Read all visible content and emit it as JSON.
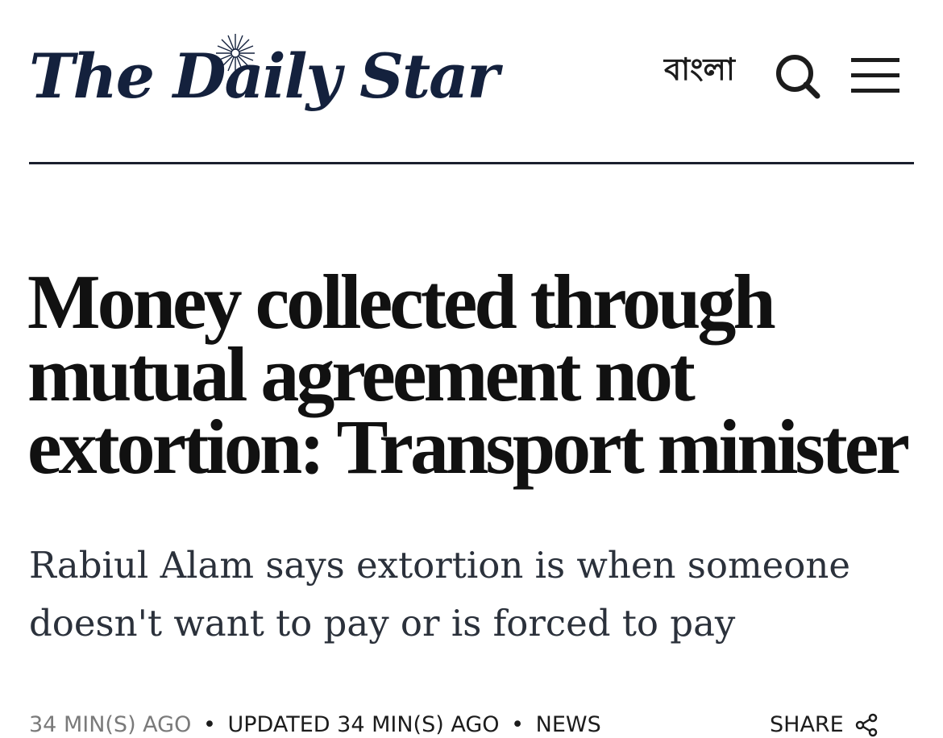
{
  "header": {
    "logo_text": "The Daily Star",
    "language_link": "বাংলা",
    "icons": {
      "search": "search-icon",
      "menu": "hamburger-menu-icon",
      "logo_star": "star-burst-icon",
      "share": "share-icon"
    }
  },
  "article": {
    "headline": "Money collected through mutual agreement not extortion: Transport minister",
    "subtitle": "Rabiul Alam says extortion is when someone doesn't want to pay or is forced to pay",
    "meta": {
      "published": "34 MIN(S) AGO",
      "updated": "UPDATED 34 MIN(S) AGO",
      "category": "NEWS",
      "separator": "•"
    },
    "share_label": "SHARE"
  },
  "colors": {
    "logo": "#14213d",
    "divider": "#1a1f2e",
    "headline": "#111111",
    "subtitle": "#2b313b",
    "meta_muted": "#7a7a7a"
  }
}
